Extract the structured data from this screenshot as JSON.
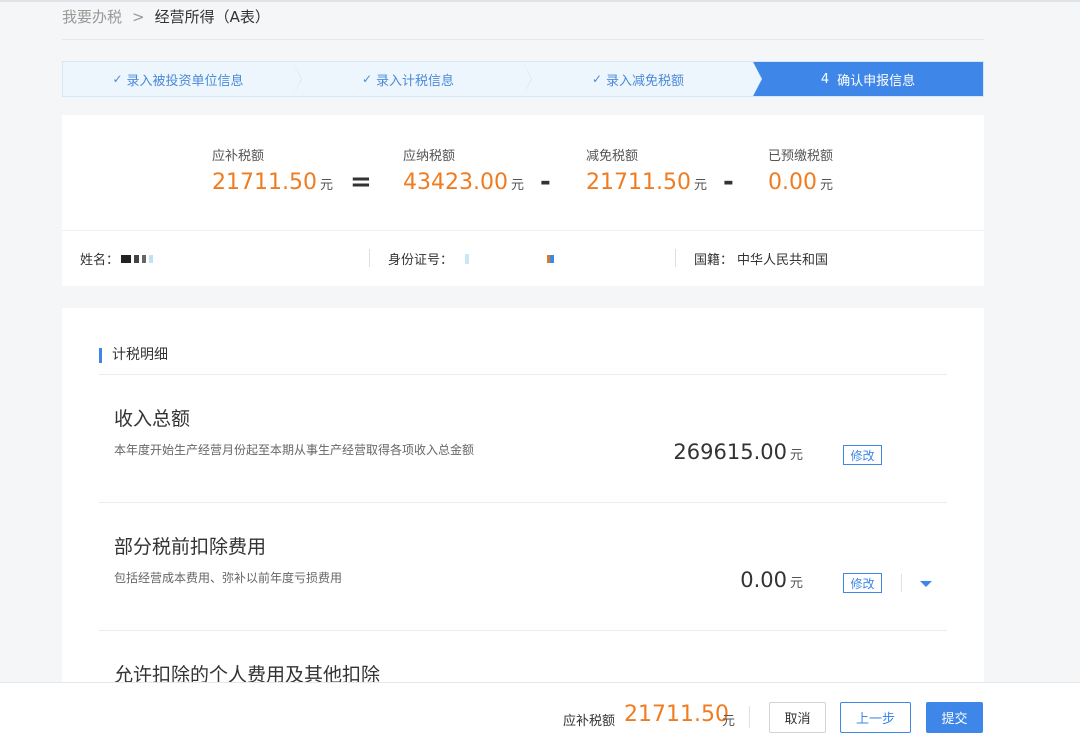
{
  "breadcrumb": {
    "root": "我要办税",
    "separator": ">",
    "current": "经营所得（A表）"
  },
  "steps": [
    {
      "label": "录入被投资单位信息",
      "done": true,
      "number": ""
    },
    {
      "label": "录入计税信息",
      "done": true,
      "number": ""
    },
    {
      "label": "录入减免税额",
      "done": true,
      "number": ""
    },
    {
      "label": "确认申报信息",
      "done": false,
      "number": "4"
    }
  ],
  "step_check": "✓",
  "summary": {
    "items": [
      {
        "label": "应补税额",
        "value": "21711.50",
        "unit": "元"
      },
      {
        "label": "应纳税额",
        "value": "43423.00",
        "unit": "元"
      },
      {
        "label": "减免税额",
        "value": "21711.50",
        "unit": "元"
      },
      {
        "label": "已预缴税额",
        "value": "0.00",
        "unit": "元"
      }
    ],
    "operators": [
      "=",
      "-",
      "-"
    ]
  },
  "taxpayer": {
    "name_label": "姓名：",
    "id_label": "身份证号：",
    "nationality_label": "国籍：",
    "nationality": "中华人民共和国"
  },
  "detail": {
    "section_title": "计税明细",
    "items": [
      {
        "title": "收入总额",
        "desc": "本年度开始生产经营月份起至本期从事生产经营取得各项收入总金额",
        "amount": "269615.00",
        "unit": "元",
        "edit": "修改"
      },
      {
        "title": "部分税前扣除费用",
        "desc": "包括经营成本费用、弥补以前年度亏损费用",
        "amount": "0.00",
        "unit": "元",
        "edit": "修改"
      },
      {
        "title": "允许扣除的个人费用及其他扣除"
      }
    ]
  },
  "footer": {
    "label": "应补税额",
    "value": "21711.50",
    "unit": "元",
    "cancel": "取消",
    "prev": "上一步",
    "submit": "提交"
  },
  "colors": {
    "accent": "#3e86e8",
    "amount": "#f07c21"
  }
}
